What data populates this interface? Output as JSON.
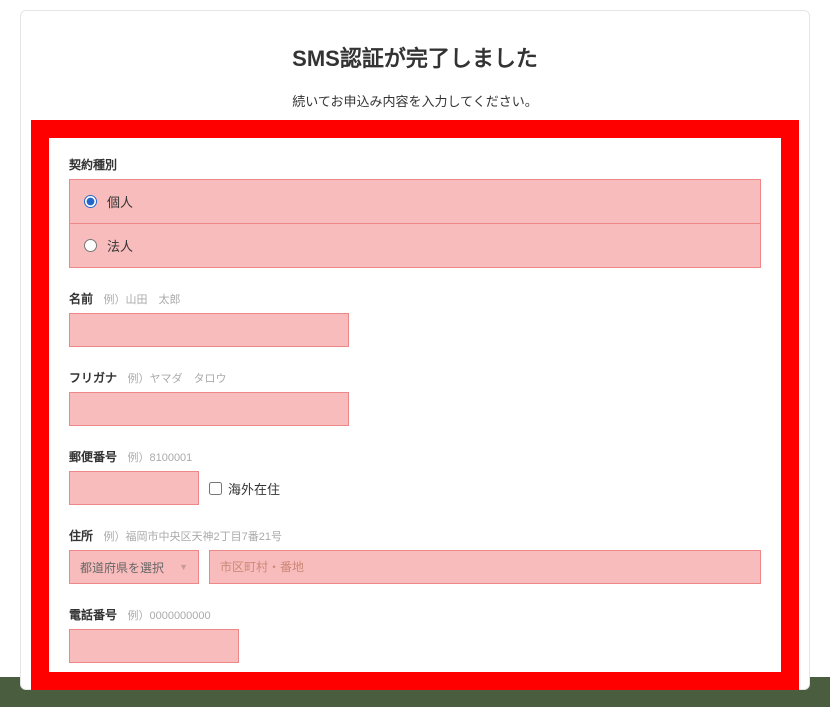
{
  "header": {
    "title": "SMS認証が完了しました",
    "subtitle": "続いてお申込み内容を入力してください。"
  },
  "fields": {
    "contract_type": {
      "label": "契約種別",
      "options": {
        "individual": "個人",
        "corporate": "法人"
      }
    },
    "name": {
      "label": "名前",
      "hint": "例）山田　太郎",
      "value": ""
    },
    "furigana": {
      "label": "フリガナ",
      "hint": "例）ヤマダ　タロウ",
      "value": ""
    },
    "postal": {
      "label": "郵便番号",
      "hint": "例）8100001",
      "value": "",
      "overseas_label": "海外在住"
    },
    "address": {
      "label": "住所",
      "hint": "例）福岡市中央区天神2丁目7番21号",
      "prefecture_placeholder": "都道府県を選択",
      "city_placeholder": "市区町村・番地"
    },
    "phone": {
      "label": "電話番号",
      "hint": "例）0000000000",
      "value": ""
    }
  }
}
